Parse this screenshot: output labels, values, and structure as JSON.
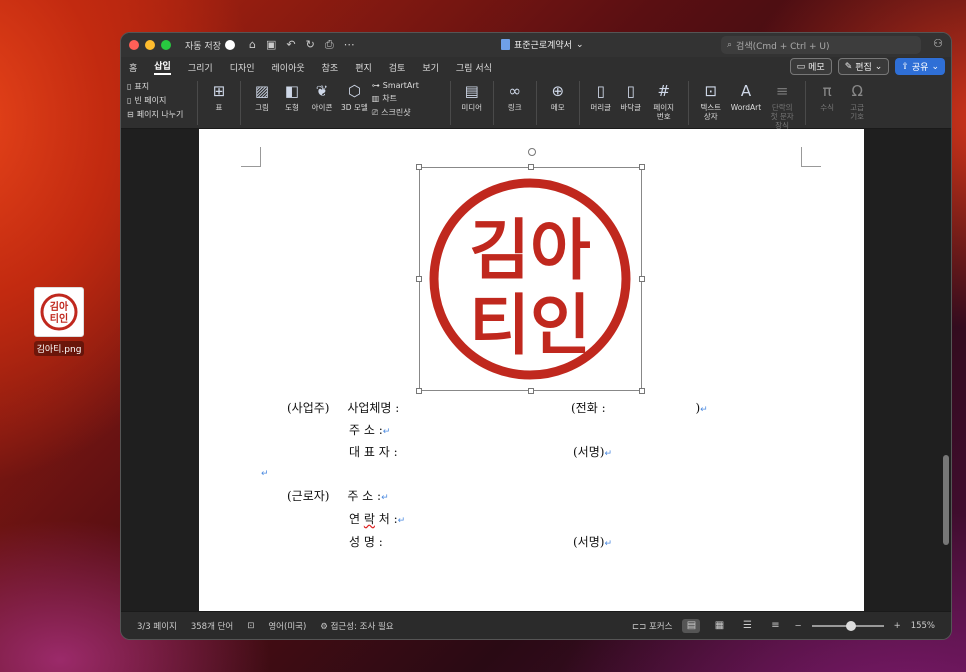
{
  "desktop": {
    "icon_label": "김아티.png",
    "stamp_text_line1": "김아",
    "stamp_text_line2": "티인"
  },
  "window": {
    "autosave_label": "자동 저장",
    "doc_title": "표준근로계약서",
    "search_placeholder": "검색(Cmd + Ctrl + U)"
  },
  "tabs": [
    "홈",
    "삽입",
    "그리기",
    "디자인",
    "레이아웃",
    "참조",
    "편지",
    "검토",
    "보기",
    "그림 서식"
  ],
  "active_tab": "삽입",
  "tab_actions": {
    "memo": "메모",
    "edit": "편집",
    "share": "공유"
  },
  "ribbon": {
    "pages": [
      "표지",
      "빈 페이지",
      "페이지 나누기"
    ],
    "table": "표",
    "picture": "그림",
    "shapes": "도형",
    "icons": "아이콘",
    "model3d": "3D 모델",
    "smartart": "SmartArt",
    "chart": "차트",
    "screenshot": "스크린샷",
    "media": "미디어",
    "link": "링크",
    "comment": "메모",
    "header": "머리글",
    "footer": "바닥글",
    "page_number": "페이지 번호",
    "textbox": "텍스트 상자",
    "wordart": "WordArt",
    "dropcap": "단락의 첫 문자 장식",
    "equation": "수식",
    "symbol": "고급 기호"
  },
  "document": {
    "employer_label": "(사업주)",
    "company_label": "사업체명 :",
    "phone_label": "(전화 :",
    "phone_close": ")",
    "address_label": "주   소 :",
    "ceo_label": "대 표 자 :",
    "sign_label": "(서명)",
    "worker_label": "(근로자)",
    "w_address_label": "주   소 :",
    "contact_label_a": "연 ",
    "contact_label_b": "락",
    "contact_label_c": " 처 :",
    "name_label": "성   명 :",
    "w_sign_label": "(서명)"
  },
  "status": {
    "page": "3/3 페이지",
    "words": "358개 단어",
    "language": "영어(미국)",
    "accessibility": "접근성: 조사 필요",
    "focus": "포커스",
    "zoom": "155%"
  },
  "colors": {
    "stamp_red": "#c0281e",
    "share_blue": "#2f6fd6"
  }
}
